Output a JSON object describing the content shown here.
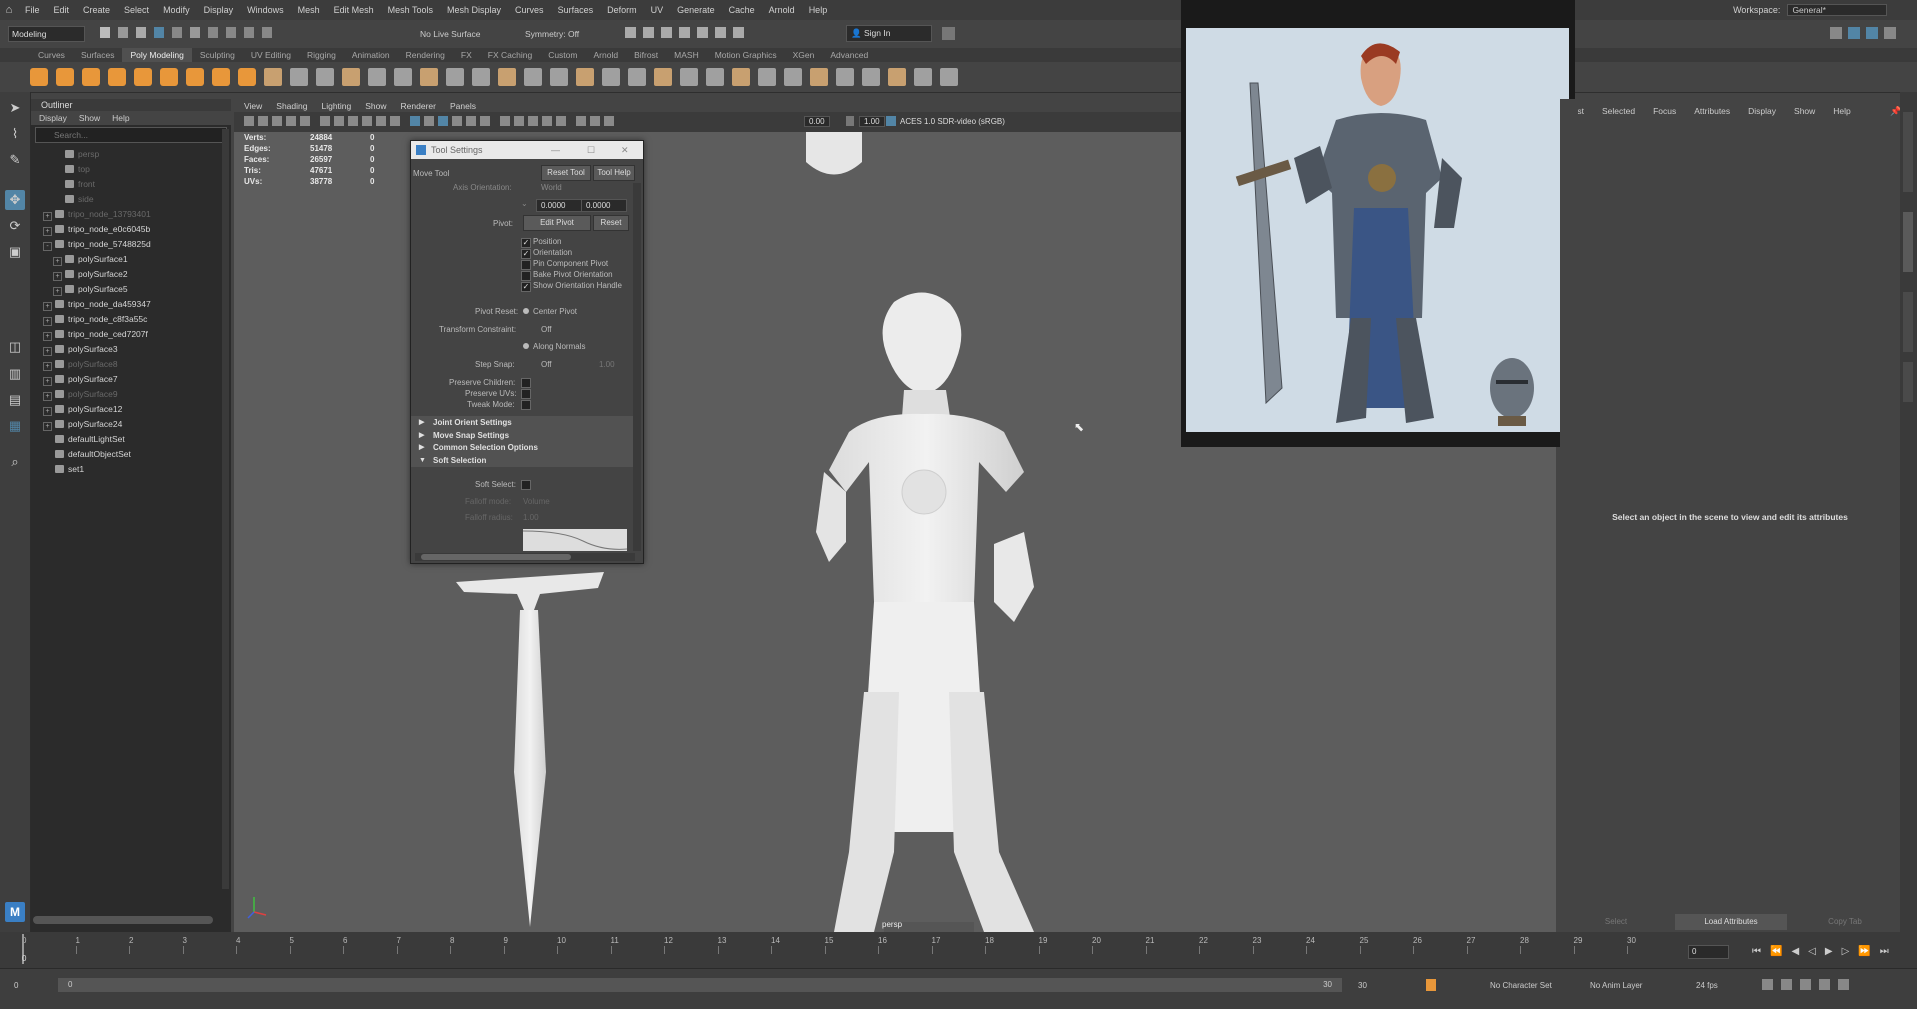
{
  "menubar": {
    "items": [
      "File",
      "Edit",
      "Create",
      "Select",
      "Modify",
      "Display",
      "Windows",
      "Mesh",
      "Edit Mesh",
      "Mesh Tools",
      "Mesh Display",
      "Curves",
      "Surfaces",
      "Deform",
      "UV",
      "Generate",
      "Cache",
      "Arnold",
      "Help"
    ],
    "workspace_label": "Workspace:",
    "workspace_value": "General*"
  },
  "status_line": {
    "mode": "Modeling",
    "live_surface": "No Live Surface",
    "symmetry": "Symmetry: Off",
    "sign_in": "Sign In"
  },
  "shelf": {
    "tabs": [
      "Curves",
      "Surfaces",
      "Poly Modeling",
      "Sculpting",
      "UV Editing",
      "Rigging",
      "Animation",
      "Rendering",
      "FX",
      "FX Caching",
      "Custom",
      "Arnold",
      "Bifrost",
      "MASH",
      "Motion Graphics",
      "XGen",
      "Advanced"
    ],
    "active_tab": "Poly Modeling"
  },
  "outliner": {
    "title": "Outliner",
    "menus": [
      "Display",
      "Show",
      "Help"
    ],
    "search_placeholder": "Search...",
    "items": [
      {
        "label": "persp",
        "dim": true,
        "indent": 1
      },
      {
        "label": "top",
        "dim": true,
        "indent": 1
      },
      {
        "label": "front",
        "dim": true,
        "indent": 1
      },
      {
        "label": "side",
        "dim": true,
        "indent": 1
      },
      {
        "label": "tripo_node_13793401",
        "dim": true,
        "indent": 0,
        "exp": "+"
      },
      {
        "label": "tripo_node_e0c6045b",
        "dim": false,
        "indent": 0,
        "exp": "+"
      },
      {
        "label": "tripo_node_5748825d",
        "dim": false,
        "indent": 0,
        "exp": "-"
      },
      {
        "label": "polySurface1",
        "dim": false,
        "indent": 1,
        "exp": "+"
      },
      {
        "label": "polySurface2",
        "dim": false,
        "indent": 1,
        "exp": "+"
      },
      {
        "label": "polySurface5",
        "dim": false,
        "indent": 1,
        "exp": "+"
      },
      {
        "label": "tripo_node_da459347",
        "dim": false,
        "indent": 0,
        "exp": "+"
      },
      {
        "label": "tripo_node_c8f3a55c",
        "dim": false,
        "indent": 0,
        "exp": "+"
      },
      {
        "label": "tripo_node_ced7207f",
        "dim": false,
        "indent": 0,
        "exp": "+"
      },
      {
        "label": "polySurface3",
        "dim": false,
        "indent": 0,
        "exp": "+"
      },
      {
        "label": "polySurface8",
        "dim": true,
        "indent": 0,
        "exp": "+"
      },
      {
        "label": "polySurface7",
        "dim": false,
        "indent": 0,
        "exp": "+"
      },
      {
        "label": "polySurface9",
        "dim": true,
        "indent": 0,
        "exp": "+"
      },
      {
        "label": "polySurface12",
        "dim": false,
        "indent": 0,
        "exp": "+"
      },
      {
        "label": "polySurface24",
        "dim": false,
        "indent": 0,
        "exp": "+"
      },
      {
        "label": "defaultLightSet",
        "dim": false,
        "indent": 0
      },
      {
        "label": "defaultObjectSet",
        "dim": false,
        "indent": 0
      },
      {
        "label": "set1",
        "dim": false,
        "indent": 0
      }
    ]
  },
  "viewport": {
    "menus": [
      "View",
      "Shading",
      "Lighting",
      "Show",
      "Renderer",
      "Panels"
    ],
    "near": "0.00",
    "far": "1.00",
    "color_space": "ACES 1.0 SDR-video (sRGB)",
    "camera_label": "persp",
    "hud": [
      {
        "label": "Verts:",
        "value": "24884",
        "sel": "0"
      },
      {
        "label": "Edges:",
        "value": "51478",
        "sel": "0"
      },
      {
        "label": "Faces:",
        "value": "26597",
        "sel": "0"
      },
      {
        "label": "Tris:",
        "value": "47671",
        "sel": "0"
      },
      {
        "label": "UVs:",
        "value": "38778",
        "sel": "0"
      }
    ]
  },
  "tool_settings": {
    "title": "Tool Settings",
    "tool_name": "Move Tool",
    "reset_tool": "Reset Tool",
    "tool_help": "Tool Help",
    "axis_orientation_label": "Axis Orientation:",
    "axis_orientation_value": "World",
    "field_1": "0.0000",
    "field_2": "0.0000",
    "pivot_label": "Pivot:",
    "edit_pivot": "Edit Pivot",
    "reset": "Reset",
    "checks": [
      {
        "label": "Position",
        "checked": true
      },
      {
        "label": "Orientation",
        "checked": true
      },
      {
        "label": "Pin Component Pivot",
        "checked": false
      },
      {
        "label": "Bake Pivot Orientation",
        "checked": false
      },
      {
        "label": "Show Orientation Handle",
        "checked": true
      }
    ],
    "pivot_reset_label": "Pivot Reset:",
    "center_pivot": "Center Pivot",
    "transform_constraint_label": "Transform Constraint:",
    "transform_constraint_value": "Off",
    "along_normals": "Along Normals",
    "step_snap_label": "Step Snap:",
    "step_snap_value": "Off",
    "step_snap_amount": "1.00",
    "preserve_children": "Preserve Children:",
    "preserve_uvs": "Preserve UVs:",
    "tweak_mode": "Tweak Mode:",
    "sections": [
      "Joint Orient Settings",
      "Move Snap Settings",
      "Common Selection Options",
      "Soft Selection"
    ],
    "soft_select_label": "Soft Select:",
    "falloff_mode_label": "Falloff mode:",
    "falloff_mode_value": "Volume",
    "falloff_radius_label": "Falloff radius:",
    "falloff_radius_value": "1.00"
  },
  "attribute_editor": {
    "menus": [
      "List",
      "Selected",
      "Focus",
      "Attributes",
      "Display",
      "Show",
      "Help"
    ],
    "empty_message": "Select an object in the scene to view and edit its attributes",
    "select_btn": "Select",
    "load_attributes_btn": "Load Attributes",
    "copy_tab_btn": "Copy Tab"
  },
  "timeline": {
    "ticks": [
      "0",
      "1",
      "2",
      "3",
      "4",
      "5",
      "6",
      "7",
      "8",
      "9",
      "10",
      "11",
      "12",
      "13",
      "14",
      "15",
      "16",
      "17",
      "18",
      "19",
      "20",
      "21",
      "22",
      "23",
      "24",
      "25",
      "26",
      "27",
      "28",
      "29",
      "30"
    ],
    "current_frame": "0",
    "current_frame_box": "0"
  },
  "range": {
    "start": "0",
    "playback_start": "0",
    "playback_end": "30",
    "end": "30",
    "character_set": "No Character Set",
    "anim_layer": "No Anim Layer",
    "fps": "24 fps"
  },
  "colors": {
    "accent": "#5285a6",
    "maya_logo": "#3a7fc4",
    "shelf_orange": "#e8973a"
  }
}
